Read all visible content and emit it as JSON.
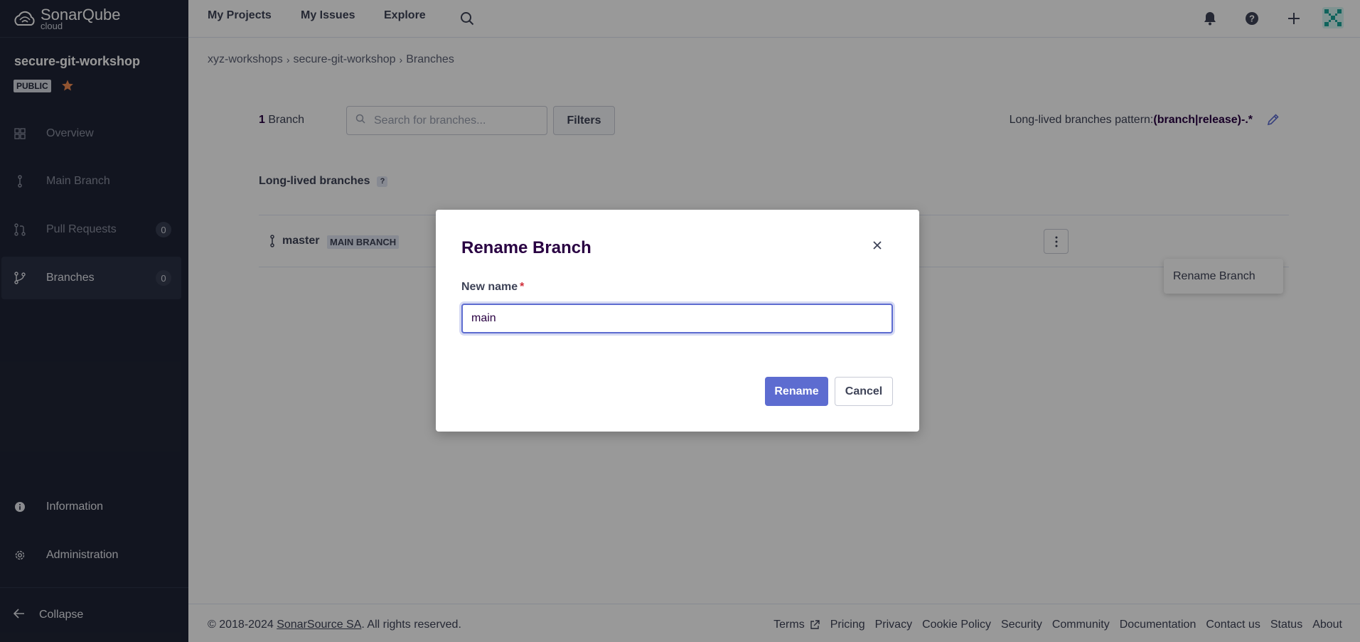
{
  "brand": {
    "name": "SonarQube",
    "sub": "cloud"
  },
  "project": {
    "name": "secure-git-workshop",
    "visibility": "PUBLIC"
  },
  "sidebar": {
    "items": [
      {
        "label": "Overview",
        "icon": "overview-icon"
      },
      {
        "label": "Main Branch",
        "icon": "branch-icon"
      },
      {
        "label": "Pull Requests",
        "icon": "pull-request-icon",
        "count": "0"
      },
      {
        "label": "Branches",
        "icon": "branches-icon",
        "count": "0"
      },
      {
        "label": "Information",
        "icon": "info-icon"
      },
      {
        "label": "Administration",
        "icon": "gear-icon"
      }
    ],
    "collapse": "Collapse"
  },
  "topnav": {
    "projects": "My Projects",
    "issues": "My Issues",
    "explore": "Explore"
  },
  "breadcrumb": [
    "xyz-workshops",
    "secure-git-workshop",
    "Branches"
  ],
  "branches": {
    "count": "1",
    "count_label": "Branch",
    "search_placeholder": "Search for branches...",
    "filters": "Filters",
    "pattern_label": "Long-lived branches pattern:",
    "pattern_value": "(branch|release)-.*",
    "section_title": "Long-lived branches",
    "help": "?",
    "rows": [
      {
        "name": "master",
        "badge": "MAIN BRANCH"
      }
    ],
    "menu_item": "Rename Branch"
  },
  "modal": {
    "title": "Rename Branch",
    "field_label": "New name",
    "required_mark": "*",
    "field_value": "main",
    "rename": "Rename",
    "cancel": "Cancel"
  },
  "footer": {
    "copyright_prefix": "© 2018-2024 ",
    "company": "SonarSource SA",
    "copyright_suffix": ". All rights reserved.",
    "links": [
      "Terms",
      "Pricing",
      "Privacy",
      "Cookie Policy",
      "Security",
      "Community",
      "Documentation",
      "Contact us",
      "Status",
      "About"
    ]
  },
  "colors": {
    "sidebar_bg": "#1f2436",
    "accent": "#5d6cd0",
    "star": "#f28c53",
    "required": "#d02f3a"
  }
}
